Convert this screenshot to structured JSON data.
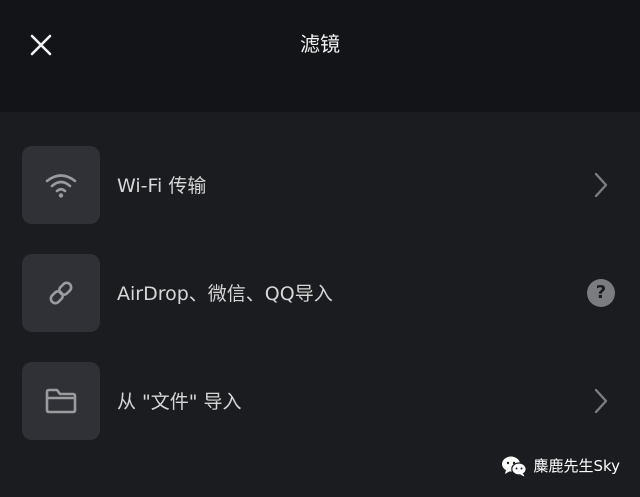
{
  "header": {
    "title": "滤镜",
    "close_icon": "close-icon"
  },
  "import_options": [
    {
      "label": "Wi-Fi 传输",
      "icon": "wifi-icon",
      "trailing": "chevron-right-icon"
    },
    {
      "label": "AirDrop、微信、QQ导入",
      "icon": "link-icon",
      "trailing": "help-icon"
    },
    {
      "label": "从 \"文件\" 导入",
      "icon": "folder-icon",
      "trailing": "chevron-right-icon"
    }
  ],
  "help_glyph": "?",
  "watermark": {
    "text": "麋鹿先生Sky",
    "icon": "wechat-icon"
  },
  "colors": {
    "background": "#1b1c20",
    "header_background": "#131418",
    "tile_background": "#303136",
    "icon_color": "#9a9b9f",
    "text": "#d6d6d6"
  }
}
